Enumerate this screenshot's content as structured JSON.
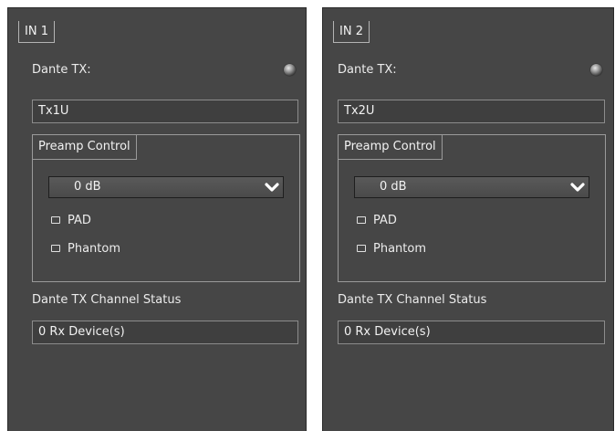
{
  "channels": [
    {
      "tab_label": "IN 1",
      "dante_tx_label": "Dante TX:",
      "dante_tx_value": "Tx1U",
      "preamp_title": "Preamp Control",
      "gain_value": "0 dB",
      "pad_label": "PAD",
      "pad_checked": false,
      "phantom_label": "Phantom",
      "phantom_checked": false,
      "status_label": "Dante TX Channel Status",
      "status_value": "0 Rx Device(s)"
    },
    {
      "tab_label": "IN 2",
      "dante_tx_label": "Dante TX:",
      "dante_tx_value": "Tx2U",
      "preamp_title": "Preamp Control",
      "gain_value": "0 dB",
      "pad_label": "PAD",
      "pad_checked": false,
      "phantom_label": "Phantom",
      "phantom_checked": false,
      "status_label": "Dante TX Channel Status",
      "status_value": "0 Rx Device(s)"
    }
  ],
  "colors": {
    "panel": "#464646",
    "field": "#3f3f3f",
    "text": "#ececec",
    "border": "#8c8c8c"
  },
  "icons": {
    "led": "status-led-icon",
    "dropdown": "chevron-down-icon",
    "checkbox": "checkbox-icon"
  }
}
